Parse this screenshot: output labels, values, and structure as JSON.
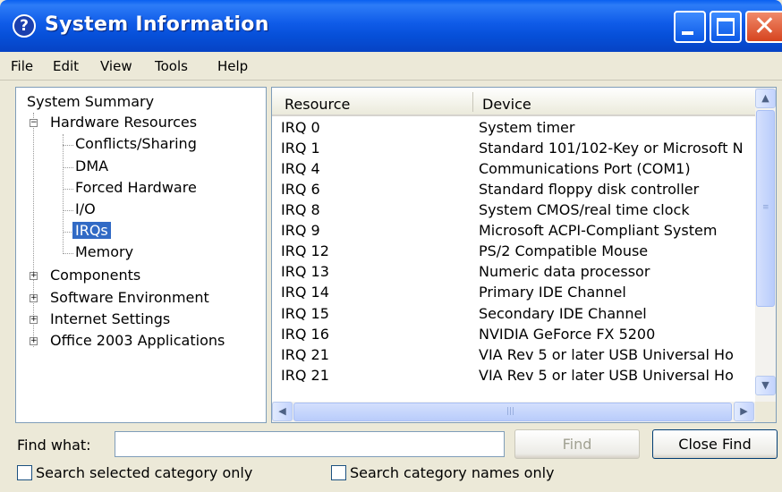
{
  "window": {
    "title": "System Information"
  },
  "menu": [
    "File",
    "Edit",
    "View",
    "Tools",
    "Help"
  ],
  "tree": {
    "root": "System Summary",
    "hardware": "Hardware Resources",
    "hardware_children": [
      "Conflicts/Sharing",
      "DMA",
      "Forced Hardware",
      "I/O",
      "IRQs",
      "Memory"
    ],
    "selected": "IRQs",
    "categories": [
      "Components",
      "Software Environment",
      "Internet Settings",
      "Office 2003 Applications"
    ]
  },
  "list": {
    "columns": [
      "Resource",
      "Device"
    ],
    "rows": [
      [
        "IRQ 0",
        "System timer"
      ],
      [
        "IRQ 1",
        "Standard 101/102-Key or Microsoft N"
      ],
      [
        "IRQ 4",
        "Communications Port (COM1)"
      ],
      [
        "IRQ 6",
        "Standard floppy disk controller"
      ],
      [
        "IRQ 8",
        "System CMOS/real time clock"
      ],
      [
        "IRQ 9",
        "Microsoft ACPI-Compliant System"
      ],
      [
        "IRQ 12",
        "PS/2 Compatible Mouse"
      ],
      [
        "IRQ 13",
        "Numeric data processor"
      ],
      [
        "IRQ 14",
        "Primary IDE Channel"
      ],
      [
        "IRQ 15",
        "Secondary IDE Channel"
      ],
      [
        "IRQ 16",
        "NVIDIA GeForce FX 5200"
      ],
      [
        "IRQ 21",
        "VIA Rev 5 or later USB Universal Ho"
      ],
      [
        "IRQ 21",
        "VIA Rev 5 or later USB Universal Ho"
      ]
    ]
  },
  "find": {
    "label": "Find what:",
    "value": "",
    "find_button": "Find",
    "close_button": "Close Find",
    "option_selected_category": "Search selected category only",
    "option_category_names": "Search category names only"
  },
  "icons": {
    "app": "help-icon",
    "minimize": "minimize-icon",
    "maximize": "maximize-icon",
    "close": "close-icon"
  },
  "colors": {
    "titlebar": "#0a5fe8",
    "selection": "#316ac5",
    "close_button": "#d6441f"
  }
}
